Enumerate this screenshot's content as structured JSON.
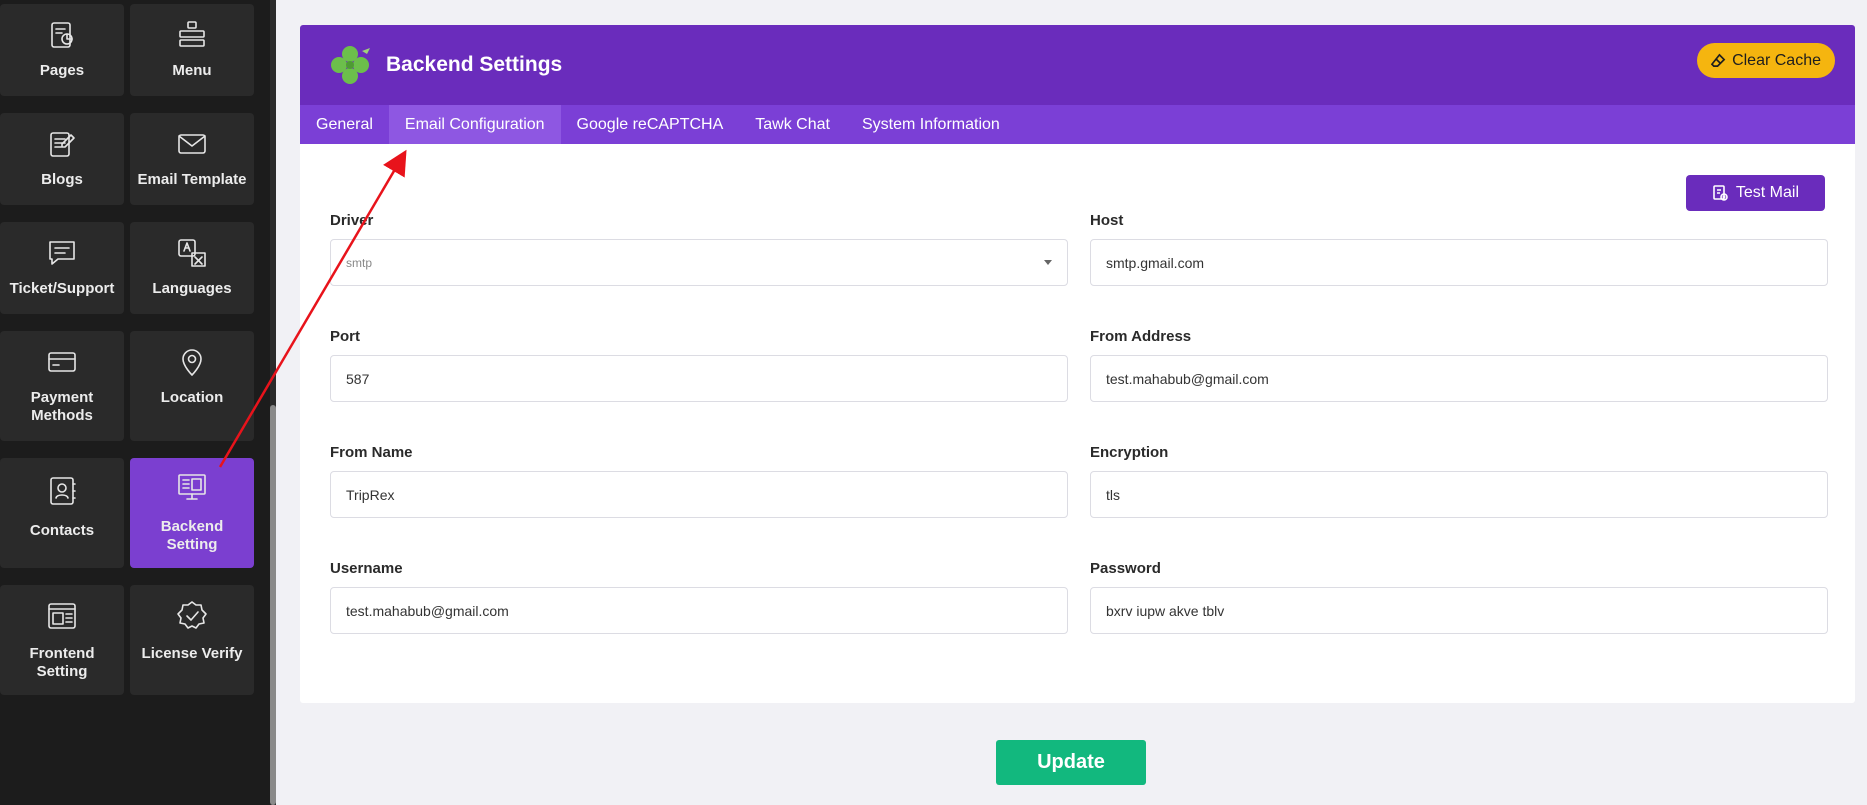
{
  "sidebar": {
    "items": [
      {
        "label": "Pages",
        "icon": "pages-chart-icon",
        "active": false
      },
      {
        "label": "Menu",
        "icon": "menu-icon",
        "active": false
      },
      {
        "label": "Blogs",
        "icon": "blog-document-icon",
        "active": false
      },
      {
        "label": "Email Template",
        "icon": "envelope-icon",
        "active": false
      },
      {
        "label": "Ticket/Support",
        "icon": "chat-bubble-icon",
        "active": false
      },
      {
        "label": "Languages",
        "icon": "translate-icon",
        "active": false
      },
      {
        "label": "Payment Methods",
        "icon": "credit-card-icon",
        "active": false
      },
      {
        "label": "Location",
        "icon": "map-pin-icon",
        "active": false
      },
      {
        "label": "Contacts",
        "icon": "contact-book-icon",
        "active": false
      },
      {
        "label": "Backend Setting",
        "icon": "monitor-settings-icon",
        "active": true
      },
      {
        "label": "Frontend Setting",
        "icon": "frontend-layout-icon",
        "active": false
      },
      {
        "label": "License Verify",
        "icon": "verified-badge-icon",
        "active": false
      }
    ]
  },
  "header": {
    "title": "Backend Settings",
    "clear_cache_label": "Clear Cache"
  },
  "tabs": [
    {
      "label": "General",
      "active": false
    },
    {
      "label": "Email Configuration",
      "active": true
    },
    {
      "label": "Google reCAPTCHA",
      "active": false
    },
    {
      "label": "Tawk Chat",
      "active": false
    },
    {
      "label": "System Information",
      "active": false
    }
  ],
  "form": {
    "test_mail_label": "Test Mail",
    "driver": {
      "label": "Driver",
      "value": "smtp"
    },
    "host": {
      "label": "Host",
      "value": "smtp.gmail.com"
    },
    "port": {
      "label": "Port",
      "value": "587"
    },
    "from_address": {
      "label": "From Address",
      "value": "test.mahabub@gmail.com"
    },
    "from_name": {
      "label": "From Name",
      "value": "TripRex"
    },
    "encryption": {
      "label": "Encryption",
      "value": "tls"
    },
    "username": {
      "label": "Username",
      "value": "test.mahabub@gmail.com"
    },
    "password": {
      "label": "Password",
      "value": "bxrv iupw akve tblv"
    },
    "update_label": "Update"
  },
  "colors": {
    "accent": "#6a2cbc",
    "tab_bar": "#7b3fd6",
    "clear_cache": "#f5b50f",
    "update": "#12b87e",
    "annotation_arrow": "#e8131b"
  }
}
